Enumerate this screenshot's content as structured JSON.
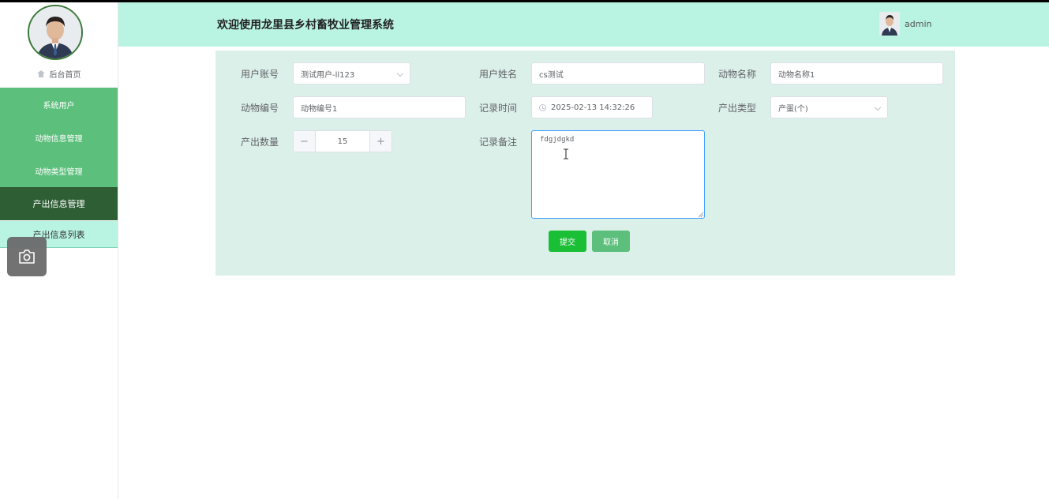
{
  "header": {
    "title": "欢迎使用龙里县乡村畜牧业管理系统",
    "username": "admin"
  },
  "sidebar": {
    "home_label": "后台首页",
    "items": [
      {
        "label": "系统用户"
      },
      {
        "label": "动物信息管理"
      },
      {
        "label": "动物类型管理"
      },
      {
        "label": "产出信息管理",
        "active": true
      }
    ],
    "submenu": {
      "label": "产出信息列表"
    }
  },
  "form": {
    "user_account": {
      "label": "用户账号",
      "value": "测试用户-ll123"
    },
    "user_name": {
      "label": "用户姓名",
      "value": "cs测试"
    },
    "animal_name": {
      "label": "动物名称",
      "value": "动物名称1"
    },
    "animal_no": {
      "label": "动物编号",
      "value": "动物编号1"
    },
    "record_time": {
      "label": "记录时间",
      "value": "2025-02-13 14:32:26"
    },
    "output_type": {
      "label": "产出类型",
      "value": "产蛋(个)"
    },
    "output_qty": {
      "label": "产出数量",
      "value": "15",
      "minus": "−",
      "plus": "+"
    },
    "remark": {
      "label": "记录备注",
      "value": "fdgjdgkd"
    },
    "submit_label": "提交",
    "cancel_label": "取消"
  },
  "icons": {
    "camera": "camera-icon",
    "home": "home-icon",
    "clock": "clock-icon",
    "chevron": "chevron-down-icon"
  },
  "colors": {
    "header_bg": "#b9f4e2",
    "menu_bg": "#5cbf7c",
    "menu_active": "#2e5e34",
    "panel_bg": "#dcf0ea",
    "submit": "#1bbf36"
  }
}
